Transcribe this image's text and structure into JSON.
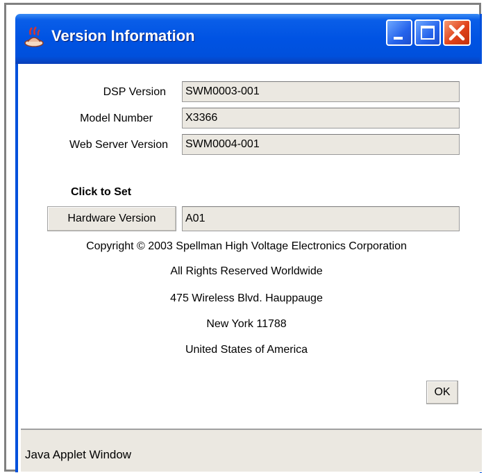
{
  "window": {
    "title": "Version Information",
    "icon": "java-applet-icon",
    "controls": [
      "minimize-icon",
      "maximize-icon",
      "close-icon"
    ]
  },
  "fields": [
    {
      "label": "DSP Version",
      "value": "SWM0003-001"
    },
    {
      "label": "Model Number",
      "value": "X3366"
    },
    {
      "label": "Web Server Version",
      "value": "SWM0004-001"
    }
  ],
  "hardware": {
    "heading": "Click to Set",
    "button_label": "Hardware Version",
    "value": "A01"
  },
  "info_lines": [
    "Copyright © 2003 Spellman High Voltage Electronics Corporation",
    "All Rights Reserved Worldwide",
    "475 Wireless Blvd. Hauppauge",
    "New York 11788",
    "United States of America"
  ],
  "ok_label": "OK",
  "status": "Java Applet Window",
  "colors": {
    "titlebar": "#0053e3",
    "field_bg": "#ebe8e1",
    "close_button": "#e0421a"
  }
}
